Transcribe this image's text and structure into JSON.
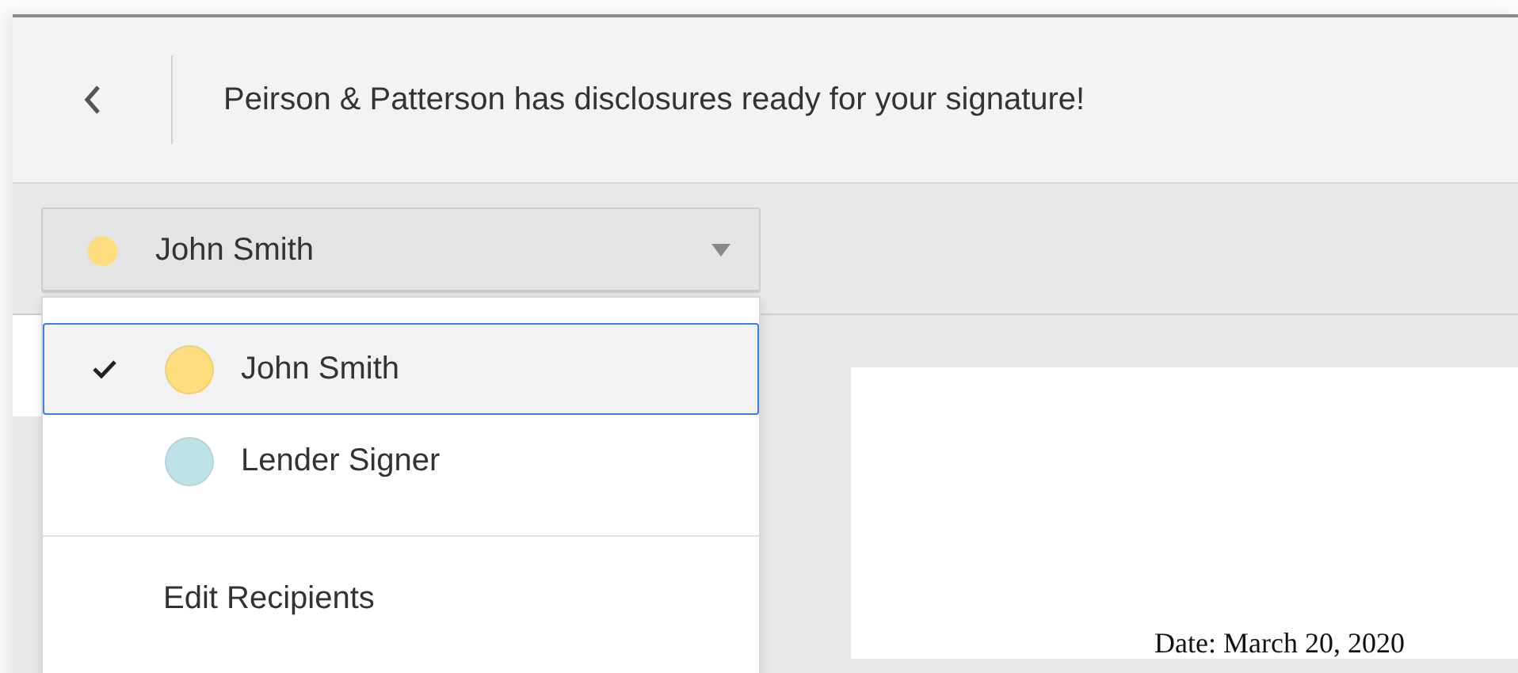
{
  "header": {
    "message": "Peirson & Patterson has disclosures ready for your signature!"
  },
  "recipient_select": {
    "value": "John Smith",
    "color": "#fddd7e",
    "expanded": true
  },
  "recipients": [
    {
      "name": "John Smith",
      "color": "#fddd7e",
      "selected": true
    },
    {
      "name": "Lender Signer",
      "color": "#bfe2e8",
      "selected": false
    }
  ],
  "menu_action": "Edit Recipients",
  "document": {
    "date_line": "Date: March 20, 2020"
  }
}
